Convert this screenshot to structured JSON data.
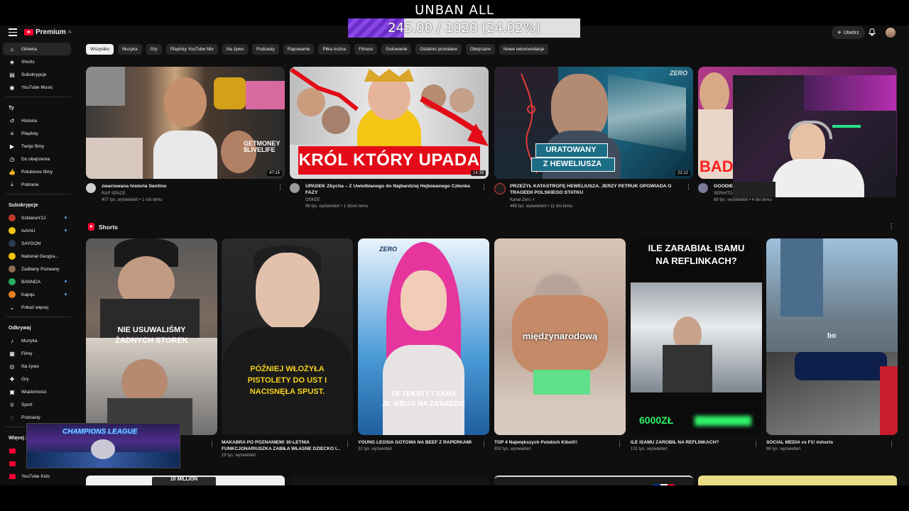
{
  "overlay": {
    "title": "UNBAN ALL",
    "progress_text": "245.00 / 1020 (24.02%)",
    "progress_fraction": 0.2402
  },
  "header": {
    "logo": "Premium",
    "logo_sup": "PL",
    "create_label": "Utwórz"
  },
  "sidebar": {
    "main": [
      {
        "label": "Główna",
        "icon": "home-icon"
      },
      {
        "label": "Shorts",
        "icon": "shorts-icon"
      },
      {
        "label": "Subskrypcje",
        "icon": "subscriptions-icon"
      },
      {
        "label": "YouTube Music",
        "icon": "music-icon"
      }
    ],
    "you_title": "Ty",
    "you": [
      {
        "label": "Historia",
        "icon": "history-icon"
      },
      {
        "label": "Playlisty",
        "icon": "playlist-icon"
      },
      {
        "label": "Twoje filmy",
        "icon": "video-icon"
      },
      {
        "label": "Do obejrzenia",
        "icon": "clock-icon"
      },
      {
        "label": "Polubione filmy",
        "icon": "like-icon"
      },
      {
        "label": "Pobrane",
        "icon": "download-icon"
      }
    ],
    "subs_title": "Subskrypcje",
    "subs": [
      {
        "label": "SzklanaY2J",
        "color": "#c0392b"
      },
      {
        "label": "IsAmU",
        "color": "#f1c40f"
      },
      {
        "label": "SAYGON",
        "color": "#2c3e50"
      },
      {
        "label": "National Geogra...",
        "color": "#f5c400"
      },
      {
        "label": "Zadbany Pozwany",
        "color": "#8e6e53"
      },
      {
        "label": "BANNDA",
        "color": "#27ae60"
      },
      {
        "label": "Kapqu",
        "color": "#e67e22"
      }
    ],
    "show_more": "Pokaż więcej",
    "explore_title": "Odkrywaj",
    "explore": [
      {
        "label": "Muzyka",
        "icon": "music-note-icon"
      },
      {
        "label": "Filmy",
        "icon": "film-icon"
      },
      {
        "label": "Na żywo",
        "icon": "live-icon"
      },
      {
        "label": "Gry",
        "icon": "gamepad-icon"
      },
      {
        "label": "Wiadomości",
        "icon": "news-icon"
      },
      {
        "label": "Sport",
        "icon": "trophy-icon"
      },
      {
        "label": "Podcasty",
        "icon": "podcast-icon"
      }
    ],
    "more_title": "Więcej z YouTube",
    "more_last": "YouTube Kids"
  },
  "chips": [
    "Wszystko",
    "Muzyka",
    "Gry",
    "Playlisty YouTube Mix",
    "Na żywo",
    "Podcasty",
    "Rapowanie",
    "Piłka nożna",
    "Fitness",
    "Gotowanie",
    "Ostatnio przesłane",
    "Obejrzane",
    "Nowe rekomendacje"
  ],
  "videos": [
    {
      "title": "zwariowana historia Sentino",
      "channel": "RAP SPACE",
      "meta": "407 tys. wyświetleń • 1 rok temu",
      "duration": "47:15"
    },
    {
      "title": "UPADEK Zbycha – Z Uwielbianego do Najbardziej Hejtowanego Członka FAZY",
      "channel": "OSKEE",
      "meta": "96 tys. wyświetleń • 1 dzień temu",
      "duration": "14:33",
      "thumb_text": "KRÓL KTÓRY UPADA"
    },
    {
      "title": "PRZEŻYŁ KATASTROFĘ HEWELIUSZA. JERZY PETRUK OPOWIADA O TRAGEDII POLSKIEGO STATKU",
      "channel": "Kanał Zero ✓",
      "meta": "469 tys. wyświetleń • 11 dni temu",
      "duration": "22:12",
      "thumb_text_1": "URATOWANY",
      "thumb_text_2": "Z HEWELIUSZA",
      "thumb_logo": "ZERO"
    },
    {
      "title": "GOODIEZ",
      "channel": "SERHITO",
      "meta": "68 tys. wyświetleń • 4 dni temu",
      "thumb_text": "BAD"
    }
  ],
  "shorts_title": "Shorts",
  "shorts": [
    {
      "title": "",
      "meta": "",
      "caption_1": "NIE USUWALIŚMY",
      "caption_2": "ŻADNYCH STOREK"
    },
    {
      "title": "MAKABRA PO POZNANIEM! 30-LETNIA FUNKCJONARIUSZKA ZABIŁA WŁASNE DZIECKO I...",
      "meta": "19 tys. wyświetleń",
      "caption_1": "PÓŹNIEJ WŁOŻYŁA",
      "caption_2": "PISTOLETY DO UST I",
      "caption_3": "NACISNĘŁA SPUST."
    },
    {
      "title": "YOUNG LEOSIA GOTOWA NA BEEF Z RAPERKAMI",
      "meta": "32 tys. wyświetleń",
      "caption_1": "TE TEKSTY I SAMA",
      "caption_2": "JE WBIJA NA ZASADZIE",
      "logo": "ZERO"
    },
    {
      "title": "TOP 4 Największych Polskich Kiboli!!",
      "meta": "952 tys. wyświetleń",
      "caption_1": "międzynarodową"
    },
    {
      "title": "ILE ISAMU ZAROBIŁ NA REFLINKACH?",
      "meta": "131 tys. wyświetleń",
      "caption_1": "ILE ZARABIAŁ ISAMU",
      "caption_2": "NA REFLINKACH?",
      "caption_3": "6000ZŁ"
    },
    {
      "title": "SOCIAL MEDIA vs F1! #shorts",
      "meta": "86 tys. wyświetleń",
      "caption_1": "bo"
    }
  ],
  "pip_title": "CHAMPIONS LEAGUE",
  "bottom_row": [
    {
      "text": "10 MILLION"
    }
  ]
}
